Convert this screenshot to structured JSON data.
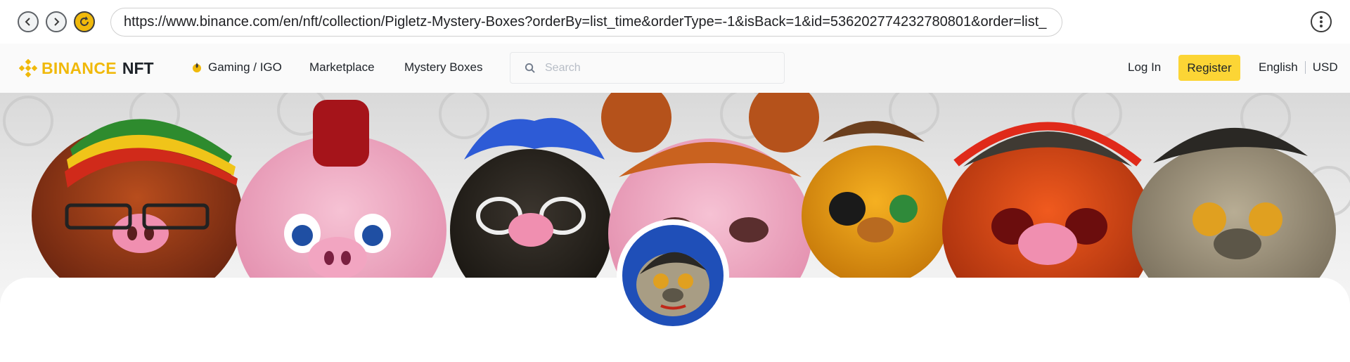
{
  "browser": {
    "url": "https://www.binance.com/en/nft/collection/Pigletz-Mystery-Boxes?orderBy=list_time&orderType=-1&isBack=1&id=536202774232780801&order=list_"
  },
  "header": {
    "logo_brand": "BINANCE",
    "logo_product": "NFT",
    "nav": {
      "gaming": "Gaming / IGO",
      "marketplace": "Marketplace",
      "mystery_boxes": "Mystery Boxes"
    },
    "search_placeholder": "Search",
    "login": "Log In",
    "register": "Register",
    "language": "English",
    "currency": "USD"
  },
  "colors": {
    "brand_yellow": "#f0b90b",
    "register_bg": "#fcd535",
    "text_dark": "#1e2329",
    "avatar_bg": "#1f4fb8"
  },
  "icons": {
    "back": "chevron-left-icon",
    "forward": "chevron-right-icon",
    "reload": "reload-icon",
    "menu": "more-vertical-icon",
    "logo": "binance-logo-icon",
    "gaming": "fire-icon",
    "search": "search-icon"
  }
}
